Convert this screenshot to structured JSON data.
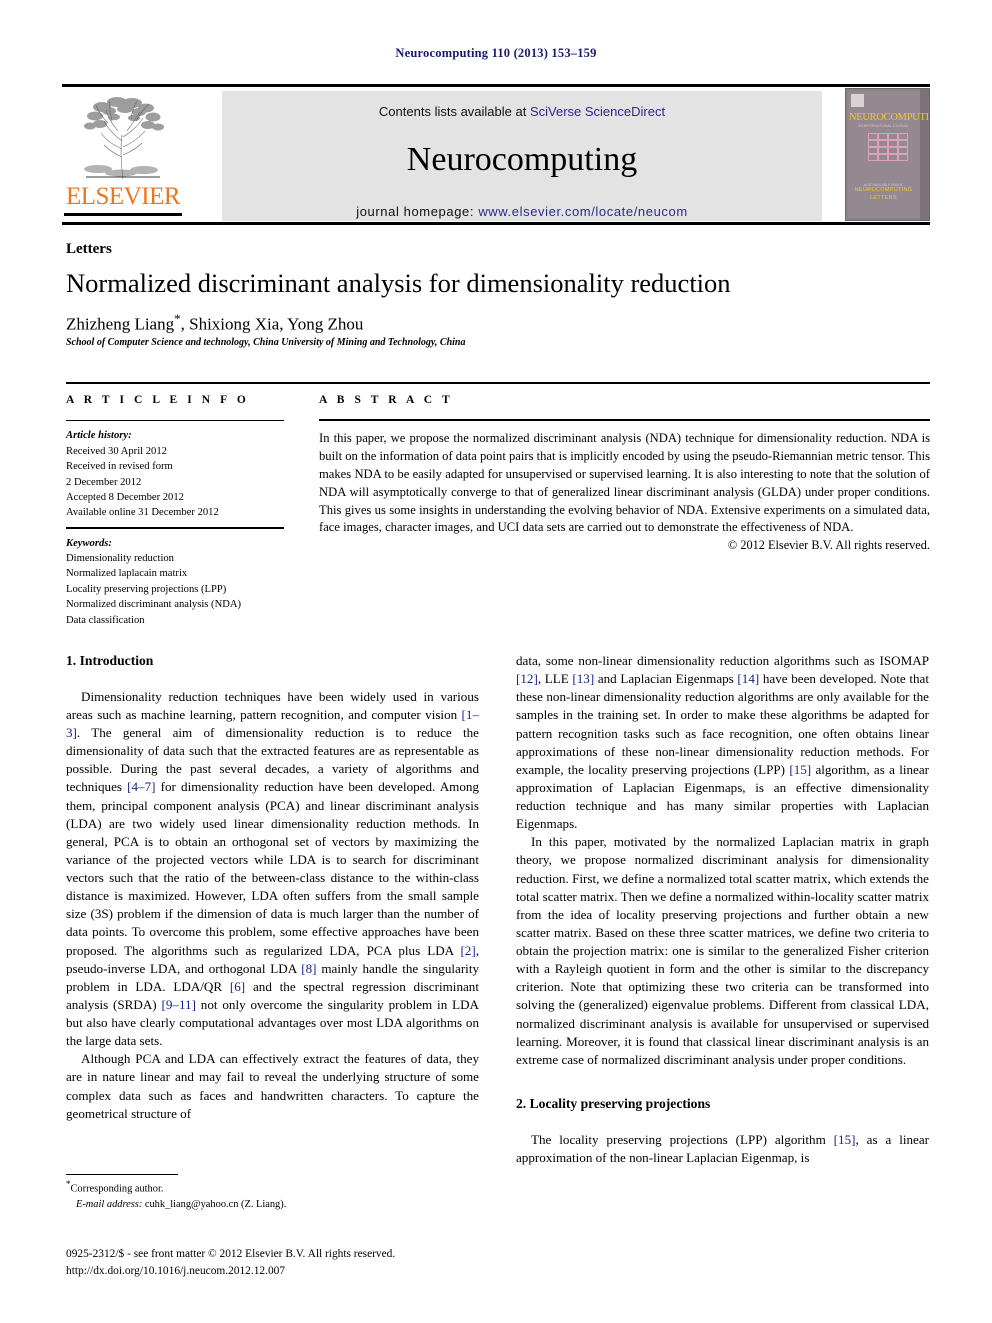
{
  "running_head": "Neurocomputing 110 (2013) 153–159",
  "masthead": {
    "contents_prefix": "Contents lists available at ",
    "sciencedirect_link": "SciVerse ScienceDirect",
    "journal_name": "Neurocomputing",
    "homepage_prefix": "journal homepage: ",
    "homepage_url": "www.elsevier.com/locate/neucom",
    "publisher_wordmark": "ELSEVIER",
    "cover": {
      "journal_title": "NEUROCOMPUTING",
      "subtitle": "AN INTERNATIONAL JOURNAL",
      "bottom_line1": "NEUROCOMPUTING",
      "bottom_line2": "LETTERS",
      "tiny_line": "ALSO AVAILABLE ONLINE"
    },
    "accent_orange": "#E87722",
    "link_blue": "#2a2a8c",
    "banner_bg": "#e3e3e3"
  },
  "article": {
    "section_label": "Letters",
    "title": "Normalized discriminant analysis for dimensionality reduction",
    "authors": "Zhizheng Liang",
    "authors_rest": ", Shixiong Xia, Yong Zhou",
    "corresponding_marker": "*",
    "affiliation": "School of Computer Science and technology, China University of Mining and Technology, China"
  },
  "info": {
    "heading": "A R T I C L E  I N F O",
    "history_label": "Article history:",
    "history": [
      "Received 30 April 2012",
      "Received in revised form",
      "2 December 2012",
      "Accepted 8 December 2012",
      "Available online 31 December 2012"
    ],
    "keywords_label": "Keywords:",
    "keywords": [
      "Dimensionality reduction",
      "Normalized laplacain matrix",
      "Locality preserving projections (LPP)",
      "Normalized discriminant analysis (NDA)",
      "Data classification"
    ]
  },
  "abstract": {
    "heading": "A B S T R A C T",
    "text": "In this paper, we propose the normalized discriminant analysis (NDA) technique for dimensionality reduction. NDA is built on the information of data point pairs that is implicitly encoded by using the pseudo-Riemannian metric tensor. This makes NDA to be easily adapted for unsupervised or supervised learning. It is also interesting to note that the solution of NDA will asymptotically converge to that of generalized linear discriminant analysis (GLDA) under proper conditions. This gives us some insights in understanding the evolving behavior of NDA. Extensive experiments on a simulated data, face images, character images, and UCI data sets are carried out to demonstrate the effectiveness of NDA.",
    "copyright": "© 2012 Elsevier B.V. All rights reserved."
  },
  "body": {
    "section1_heading": "1.  Introduction",
    "section2_heading": "2.  Locality preserving projections",
    "left_p1_a": "Dimensionality reduction techniques have been widely used in various areas such as machine learning, pattern recognition, and computer vision ",
    "left_p1_ref1": "[1–3]",
    "left_p1_b": ". The general aim of dimensionality reduction is to reduce the dimensionality of data such that the extracted features are as representable as possible. During the past several decades, a variety of algorithms and techniques ",
    "left_p1_ref2": "[4–7]",
    "left_p1_c": " for dimensionality reduction have been developed. Among them, principal component analysis (PCA) and linear discriminant analysis (LDA) are two widely used linear dimensionality reduction methods. In general, PCA is to obtain an orthogonal set of vectors by maximizing the variance of the projected vectors while LDA is to search for discriminant vectors such that the ratio of the between-class distance to the within-class distance is maximized. However, LDA often suffers from the small sample size (3S) problem if the dimension of data is much larger than the number of data points. To overcome this problem, some effective approaches have been proposed. The algorithms such as regularized LDA, PCA plus LDA ",
    "left_p1_ref3": "[2]",
    "left_p1_d": ", pseudo-inverse LDA, and orthogonal LDA ",
    "left_p1_ref4": "[8]",
    "left_p1_e": " mainly handle the singularity problem in LDA. LDA/QR ",
    "left_p1_ref5": "[6]",
    "left_p1_f": " and the spectral regression discriminant analysis (SRDA) ",
    "left_p1_ref6": "[9–11]",
    "left_p1_g": " not only overcome the singularity problem in LDA but also have clearly computational advantages over most LDA algorithms on the large data sets.",
    "left_p2": "Although PCA and LDA can effectively extract the features of data, they are in nature linear and may fail to reveal the underlying structure of some complex data such as faces and handwritten characters. To capture the geometrical structure of",
    "right_p1_a": "data, some non-linear dimensionality reduction algorithms such as ISOMAP ",
    "right_p1_ref1": "[12]",
    "right_p1_b": ", LLE ",
    "right_p1_ref2": "[13]",
    "right_p1_c": " and Laplacian Eigenmaps ",
    "right_p1_ref3": "[14]",
    "right_p1_d": " have been developed. Note that these non-linear dimensionality reduction algorithms are only available for the samples in the training set. In order to make these algorithms be adapted for pattern recognition tasks such as face recognition, one often obtains linear approximations of these non-linear dimensionality reduction methods. For example, the locality preserving projections (LPP) ",
    "right_p1_ref4": "[15]",
    "right_p1_e": " algorithm, as a linear approximation of Laplacian Eigenmaps, is an effective dimensionality reduction technique and has many similar properties with Laplacian Eigenmaps.",
    "right_p2": "In this paper, motivated by the normalized Laplacian matrix in graph theory, we propose normalized discriminant analysis for dimensionality reduction. First, we define a normalized total scatter matrix, which extends the total scatter matrix. Then we define a normalized within-locality scatter matrix from the idea of locality preserving projections and further obtain a new scatter matrix. Based on these three scatter matrices, we define two criteria to obtain the projection matrix: one is similar to the generalized Fisher criterion with a Rayleigh quotient in form and the other is similar to the discrepancy criterion. Note that optimizing these two criteria can be transformed into solving the (generalized) eigenvalue problems. Different from classical LDA, normalized discriminant analysis is available for unsupervised or supervised learning. Moreover, it is found that classical linear discriminant analysis is an extreme case of normalized discriminant analysis under proper conditions.",
    "right_p3_a": "The locality preserving projections (LPP) algorithm ",
    "right_p3_ref1": "[15]",
    "right_p3_b": ", as a linear approximation of the non-linear Laplacian Eigenmap, is"
  },
  "footnote": {
    "corresponding_marker": "*",
    "corresponding_text": "Corresponding author.",
    "email_label": "E-mail address:",
    "email": " cuhk_liang@yahoo.cn (Z. Liang)."
  },
  "footer": {
    "issn_line": "0925-2312/$ - see front matter © 2012 Elsevier B.V. All rights reserved.",
    "doi_line": "http://dx.doi.org/10.1016/j.neucom.2012.12.007"
  }
}
